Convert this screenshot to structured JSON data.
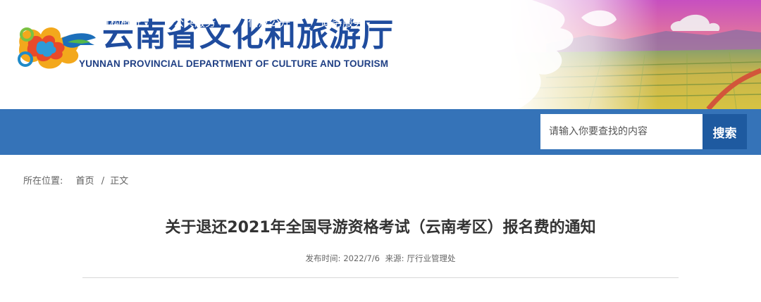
{
  "header": {
    "title": "云南省文化和旅游厅",
    "subtitle": "YUNNAN PROVINCIAL DEPARTMENT OF CULTURE AND TOURISM"
  },
  "nav": {
    "items": [
      {
        "label": "首　页"
      },
      {
        "label": "机构概况",
        "caret": "▾"
      },
      {
        "label": "公共服务",
        "caret": "▾"
      },
      {
        "label": "信息公开",
        "caret": "▾"
      },
      {
        "label": "政务服务",
        "caret": "▾"
      },
      {
        "label": "互动交流",
        "caret": "▾"
      }
    ]
  },
  "search": {
    "placeholder": "请输入你要查找的内容",
    "button_label": "搜索"
  },
  "breadcrumb": {
    "prefix": "所在位置:",
    "home": "首页",
    "separator": "/",
    "current": "正文"
  },
  "article": {
    "title": "关于退还2021年全国导游资格考试（云南考区）报名费的通知",
    "published_label": "发布时间:",
    "published_date": "2022/7/6",
    "source_label": "来源:",
    "source": "厅行业管理处"
  },
  "colors": {
    "brand_blue": "#1f4c9e",
    "nav_bar": "#3573b8",
    "search_button": "#1e5aa0"
  }
}
